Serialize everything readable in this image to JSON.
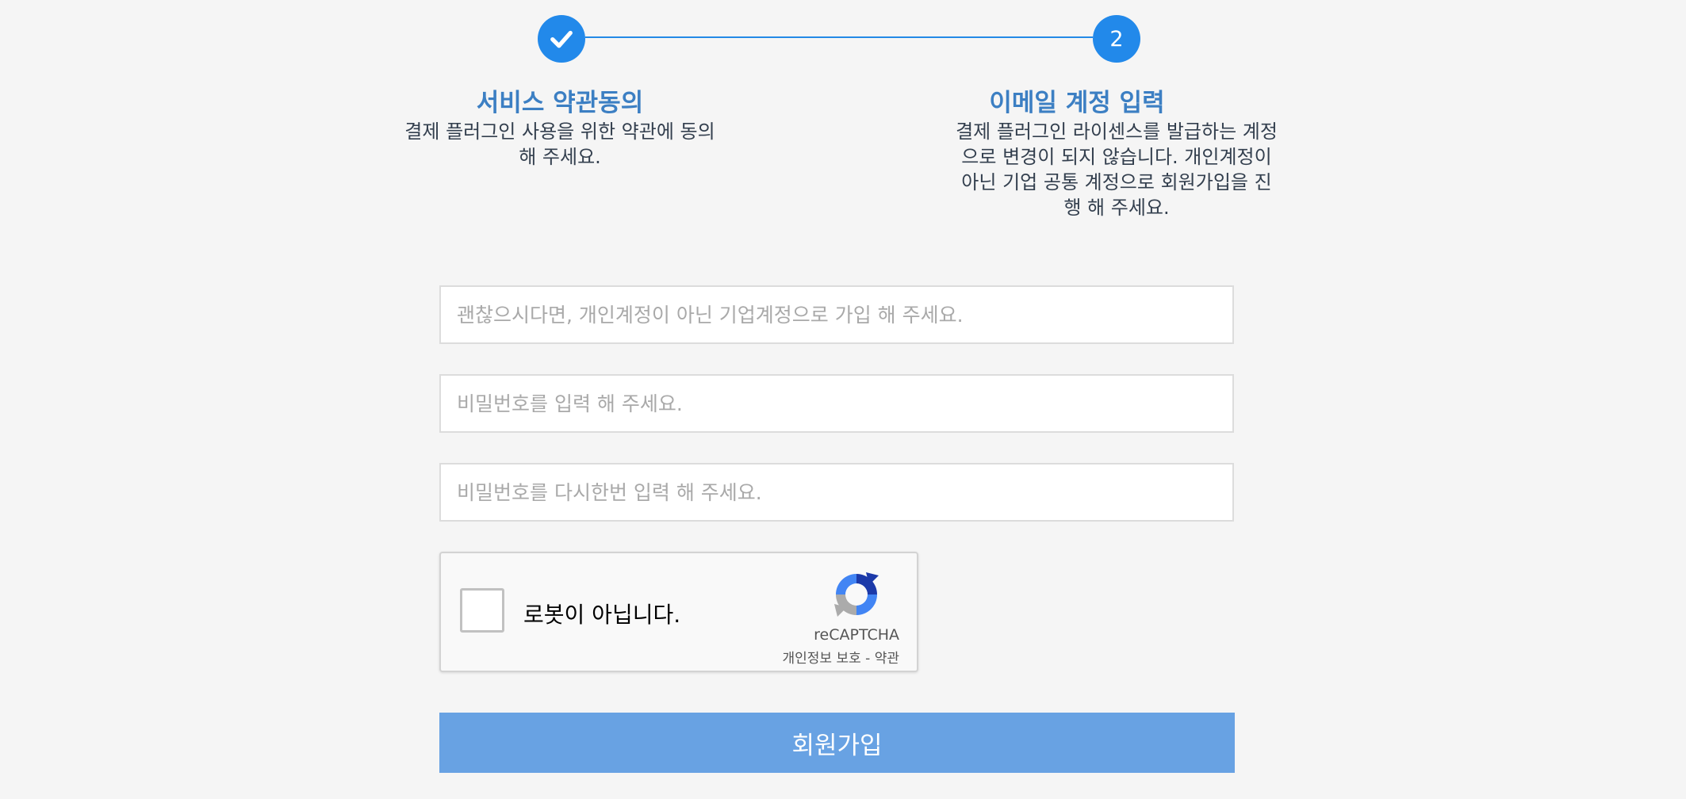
{
  "steps": [
    {
      "indicator": "",
      "icon": "check-icon",
      "title": "서비스 약관동의",
      "description": "결제 플러그인 사용을 위한 약관에 동의 해 주세요."
    },
    {
      "indicator": "2",
      "title": "이메일 계정 입력",
      "description": "결제 플러그인 라이센스를 발급하는 계정으로 변경이 되지 않습니다. 개인계정이 아닌 기업 공통 계정으로 회원가입을 진행 해 주세요."
    }
  ],
  "form": {
    "email_placeholder": "괜찮으시다면, 개인계정이 아닌 기업계정으로 가입 해 주세요.",
    "password_placeholder": "비밀번호를 입력 해 주세요.",
    "password_confirm_placeholder": "비밀번호를 다시한번 입력 해 주세요.",
    "submit_label": "회원가입"
  },
  "recaptcha": {
    "label": "로봇이 아닙니다.",
    "brand": "reCAPTCHA",
    "privacy_link": "개인정보 보호",
    "separator": " - ",
    "terms_link": "약관"
  },
  "colors": {
    "accent": "#2289ea",
    "title": "#3c7fc3",
    "submit": "#68a2e3",
    "background": "#f5f5f5"
  }
}
